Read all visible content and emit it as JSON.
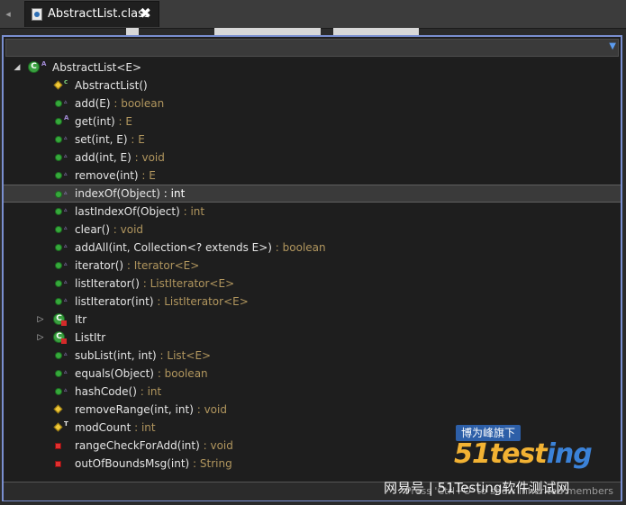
{
  "editor": {
    "tab_title": "AbstractList.class",
    "tab_close": "✖"
  },
  "outline": {
    "filter_value": "",
    "dropdown_glyph": "▼",
    "root": {
      "label": "AbstractList<E>",
      "icon": "class-icon",
      "expanded": true
    },
    "items": [
      {
        "name": "AbstractList()",
        "type": "",
        "icon": "constructor-diamond-icon"
      },
      {
        "name": "add(E)",
        "type": " : boolean",
        "icon": "public-method-icon"
      },
      {
        "name": "get(int)",
        "type": " : E",
        "icon": "public-abstract-method-icon"
      },
      {
        "name": "set(int, E)",
        "type": " : E",
        "icon": "public-method-icon"
      },
      {
        "name": "add(int, E)",
        "type": " : void",
        "icon": "public-method-icon"
      },
      {
        "name": "remove(int)",
        "type": " : E",
        "icon": "public-method-icon"
      },
      {
        "name": "indexOf(Object)",
        "type": " : int",
        "icon": "public-method-icon",
        "selected": true
      },
      {
        "name": "lastIndexOf(Object)",
        "type": " : int",
        "icon": "public-method-icon"
      },
      {
        "name": "clear()",
        "type": " : void",
        "icon": "public-method-icon"
      },
      {
        "name": "addAll(int, Collection<? extends E>)",
        "type": " : boolean",
        "icon": "public-method-icon"
      },
      {
        "name": "iterator()",
        "type": " : Iterator<E>",
        "icon": "public-method-icon"
      },
      {
        "name": "listIterator()",
        "type": " : ListIterator<E>",
        "icon": "public-method-icon"
      },
      {
        "name": "listIterator(int)",
        "type": " : ListIterator<E>",
        "icon": "public-method-icon"
      },
      {
        "name": "Itr",
        "type": "",
        "icon": "inner-class-icon",
        "expandable": true
      },
      {
        "name": "ListItr",
        "type": "",
        "icon": "inner-class-icon",
        "expandable": true
      },
      {
        "name": "subList(int, int)",
        "type": " : List<E>",
        "icon": "public-method-icon"
      },
      {
        "name": "equals(Object)",
        "type": " : boolean",
        "icon": "public-method-icon"
      },
      {
        "name": "hashCode()",
        "type": " : int",
        "icon": "public-method-icon"
      },
      {
        "name": "removeRange(int, int)",
        "type": " : void",
        "icon": "protected-method-icon"
      },
      {
        "name": "modCount",
        "type": " : int",
        "icon": "protected-field-icon"
      },
      {
        "name": "rangeCheckForAdd(int)",
        "type": " : void",
        "icon": "private-method-icon"
      },
      {
        "name": "outOfBoundsMsg(int)",
        "type": " : String",
        "icon": "private-method-icon"
      }
    ],
    "status_hint": "Press 'Ctrl+O' to show inherited members"
  },
  "watermark": {
    "badge": "博为峰旗下",
    "logo_main": "51test",
    "logo_tail": "ing",
    "footer": "网易号 | 51Testing软件测试网"
  },
  "colors": {
    "selection_border": "#606060",
    "popup_border": "#7a8fd0",
    "return_type": "#b1965e"
  }
}
